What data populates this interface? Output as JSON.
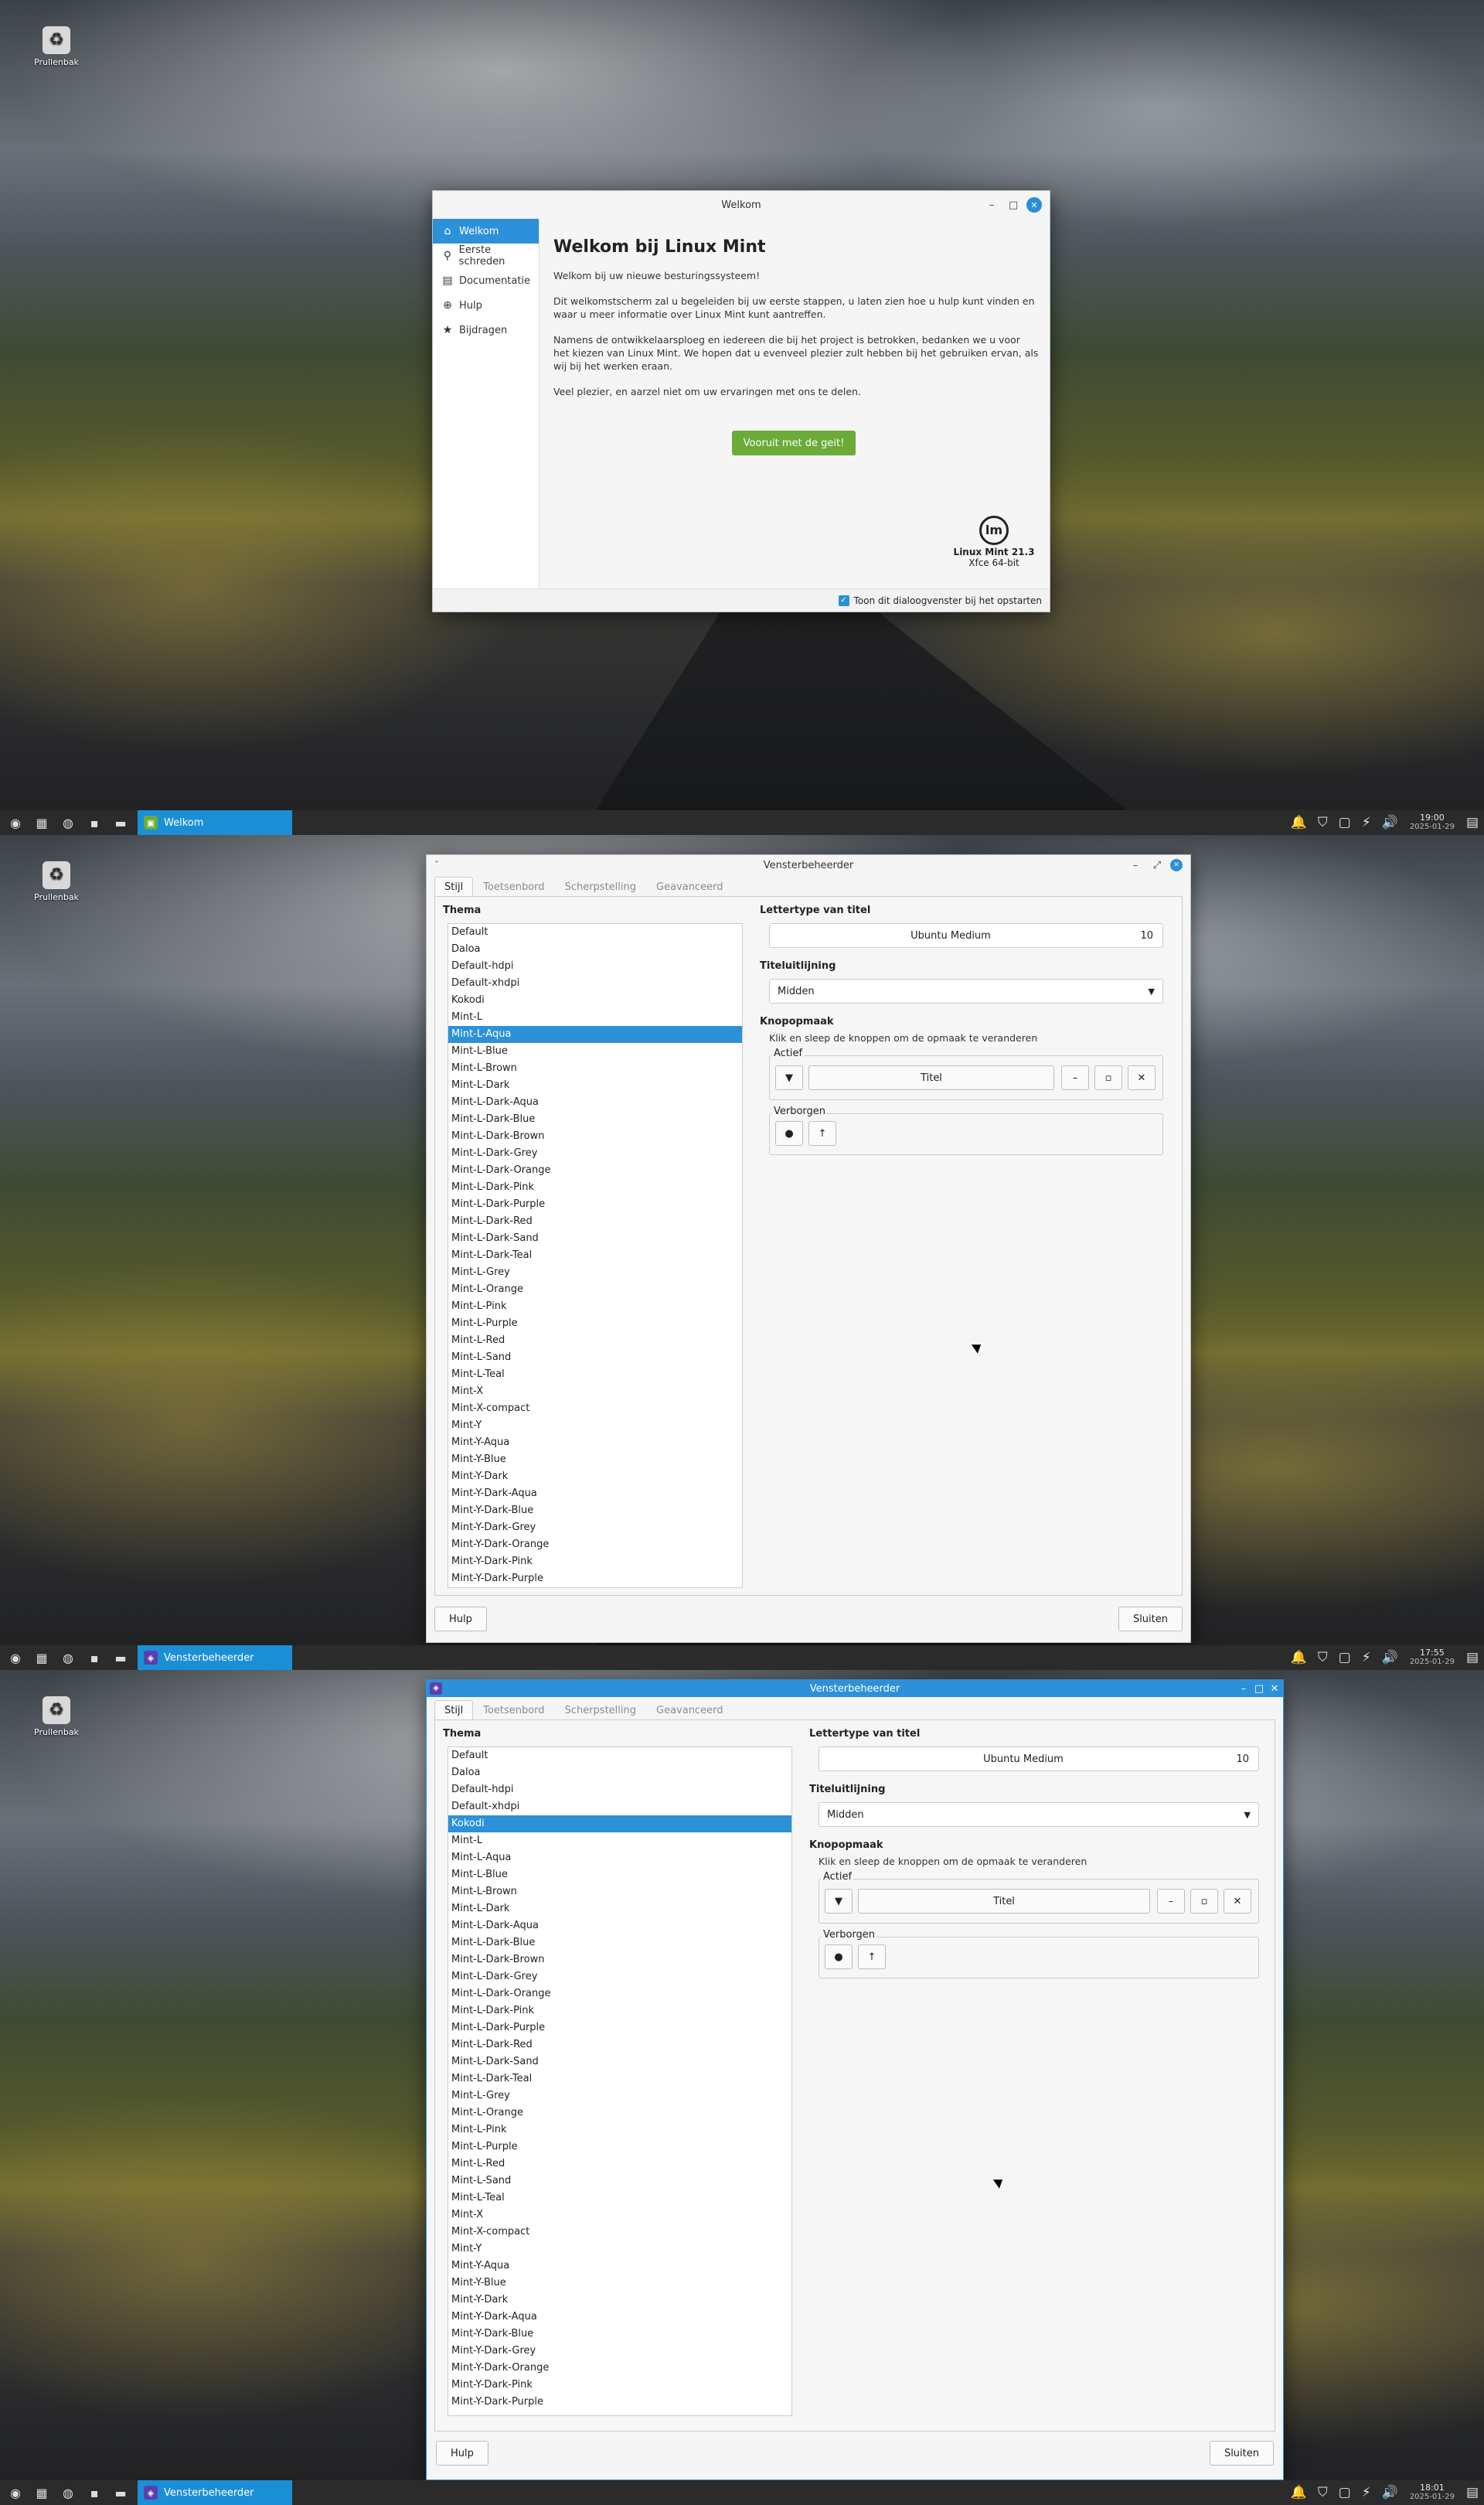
{
  "desktop": {
    "trash_label": "Prullenbak"
  },
  "welcome": {
    "title": "Welkom",
    "nav": [
      {
        "label": "Welkom",
        "icon": "home-icon"
      },
      {
        "label": "Eerste schreden",
        "icon": "pin-icon"
      },
      {
        "label": "Documentatie",
        "icon": "book-icon"
      },
      {
        "label": "Hulp",
        "icon": "help-icon"
      },
      {
        "label": "Bijdragen",
        "icon": "star-icon"
      }
    ],
    "heading": "Welkom bij Linux Mint",
    "p1": "Welkom bij uw nieuwe besturingssysteem!",
    "p2": "Dit welkomstscherm zal u begeleiden bij uw eerste stappen, u laten zien hoe u hulp kunt vinden en waar u meer informatie over Linux Mint kunt aantreffen.",
    "p3": "Namens de ontwikkelaarsploeg en iedereen die bij het project is betrokken, bedanken we u voor het kiezen van Linux Mint. We hopen dat u evenveel plezier zult hebben bij het gebruiken ervan, als wij bij het werken eraan.",
    "p4": "Veel plezier, en aarzel niet om uw ervaringen met ons te delen.",
    "button": "Vooruit met de geit!",
    "version": "Linux Mint 21.3",
    "edition": "Xfce 64-bit",
    "show_at_start": "Toon dit dialoogvenster bij het opstarten"
  },
  "wm": {
    "title": "Vensterbeheerder",
    "tabs": [
      "Stijl",
      "Toetsenbord",
      "Scherpstelling",
      "Geavanceerd"
    ],
    "theme_header": "Thema",
    "themes": [
      "Default",
      "Daloa",
      "Default-hdpi",
      "Default-xhdpi",
      "Kokodi",
      "Mint-L",
      "Mint-L-Aqua",
      "Mint-L-Blue",
      "Mint-L-Brown",
      "Mint-L-Dark",
      "Mint-L-Dark-Aqua",
      "Mint-L-Dark-Blue",
      "Mint-L-Dark-Brown",
      "Mint-L-Dark-Grey",
      "Mint-L-Dark-Orange",
      "Mint-L-Dark-Pink",
      "Mint-L-Dark-Purple",
      "Mint-L-Dark-Red",
      "Mint-L-Dark-Sand",
      "Mint-L-Dark-Teal",
      "Mint-L-Grey",
      "Mint-L-Orange",
      "Mint-L-Pink",
      "Mint-L-Purple",
      "Mint-L-Red",
      "Mint-L-Sand",
      "Mint-L-Teal",
      "Mint-X",
      "Mint-X-compact",
      "Mint-Y",
      "Mint-Y-Aqua",
      "Mint-Y-Blue",
      "Mint-Y-Dark",
      "Mint-Y-Dark-Aqua",
      "Mint-Y-Dark-Blue",
      "Mint-Y-Dark-Grey",
      "Mint-Y-Dark-Orange",
      "Mint-Y-Dark-Pink",
      "Mint-Y-Dark-Purple"
    ],
    "selected_1": "Mint-L-Aqua",
    "selected_2": "Kokodi",
    "font_header": "Lettertype van titel",
    "font_name": "Ubuntu Medium",
    "font_size": "10",
    "align_header": "Titeluitlijning",
    "align_value": "Midden",
    "layout_header": "Knopopmaak",
    "layout_hint": "Klik en sleep de knoppen om de opmaak te veranderen",
    "active_label": "Actief",
    "hidden_label": "Verborgen",
    "title_slot": "Titel",
    "help_button": "Hulp",
    "close_button": "Sluiten"
  },
  "taskbar": {
    "task1": "Welkom",
    "task2": "Vensterbeheerder",
    "clock1": "19:00",
    "clock2": "17:55",
    "clock3": "18:01",
    "date": "2025-01-29"
  },
  "colors": {
    "accent": "#2c91d8",
    "button_green": "#6aab3a",
    "taskbar": "#2b2b2b"
  }
}
